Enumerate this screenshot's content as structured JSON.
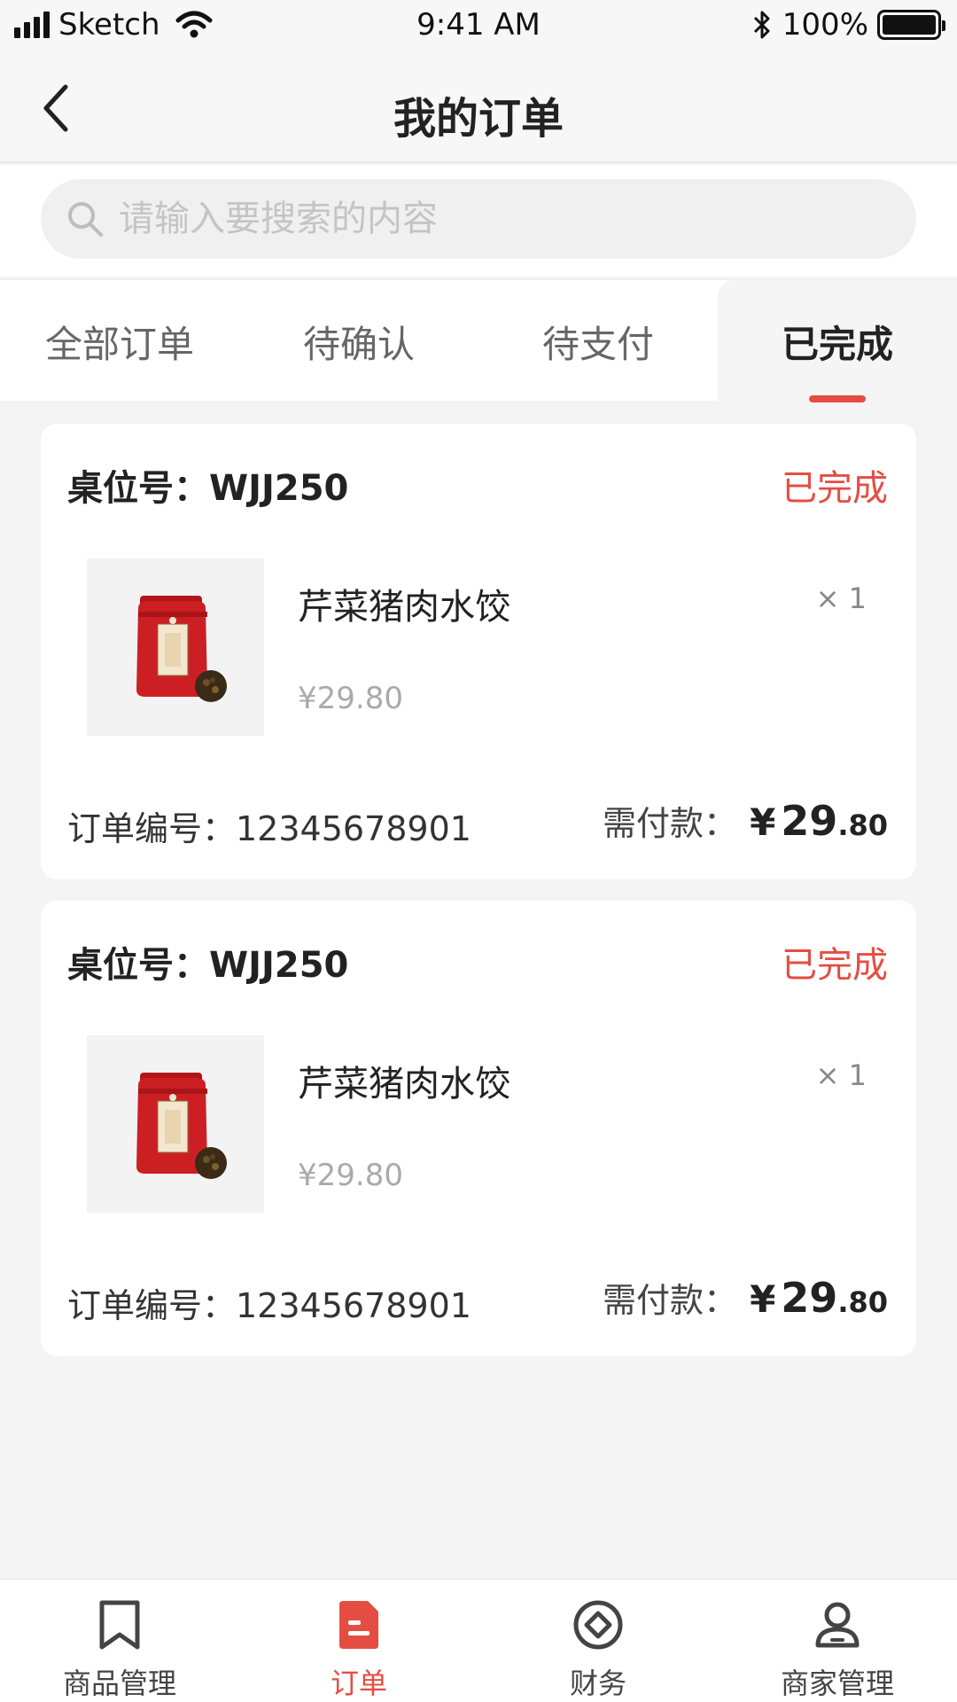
{
  "status_bar": {
    "carrier": "Sketch",
    "time": "9:41 AM",
    "battery": "100%"
  },
  "nav": {
    "title": "我的订单"
  },
  "search": {
    "placeholder": "请输入要搜索的内容"
  },
  "tabs": [
    {
      "label": "全部订单",
      "active": false
    },
    {
      "label": "待确认",
      "active": false
    },
    {
      "label": "待支付",
      "active": false
    },
    {
      "label": "已完成",
      "active": true
    }
  ],
  "orders": [
    {
      "table_label": "桌位号：WJJ250",
      "status": "已完成",
      "item_name": "芹菜猪肉水饺",
      "quantity": "× 1",
      "price": "¥29.80",
      "order_no": "订单编号：12345678901",
      "pay_label": "需付款：",
      "pay_currency": "¥",
      "pay_integer": "29",
      "pay_decimal": ".80"
    },
    {
      "table_label": "桌位号：WJJ250",
      "status": "已完成",
      "item_name": "芹菜猪肉水饺",
      "quantity": "× 1",
      "price": "¥29.80",
      "order_no": "订单编号：12345678901",
      "pay_label": "需付款：",
      "pay_currency": "¥",
      "pay_integer": "29",
      "pay_decimal": ".80"
    }
  ],
  "tab_bar": [
    {
      "label": "商品管理",
      "icon": "bookmark-icon",
      "active": false
    },
    {
      "label": "订单",
      "icon": "order-document-icon",
      "active": true
    },
    {
      "label": "财务",
      "icon": "finance-icon",
      "active": false
    },
    {
      "label": "商家管理",
      "icon": "merchant-user-icon",
      "active": false
    }
  ],
  "colors": {
    "accent": "#e54d42",
    "background": "#f4f4f4"
  }
}
